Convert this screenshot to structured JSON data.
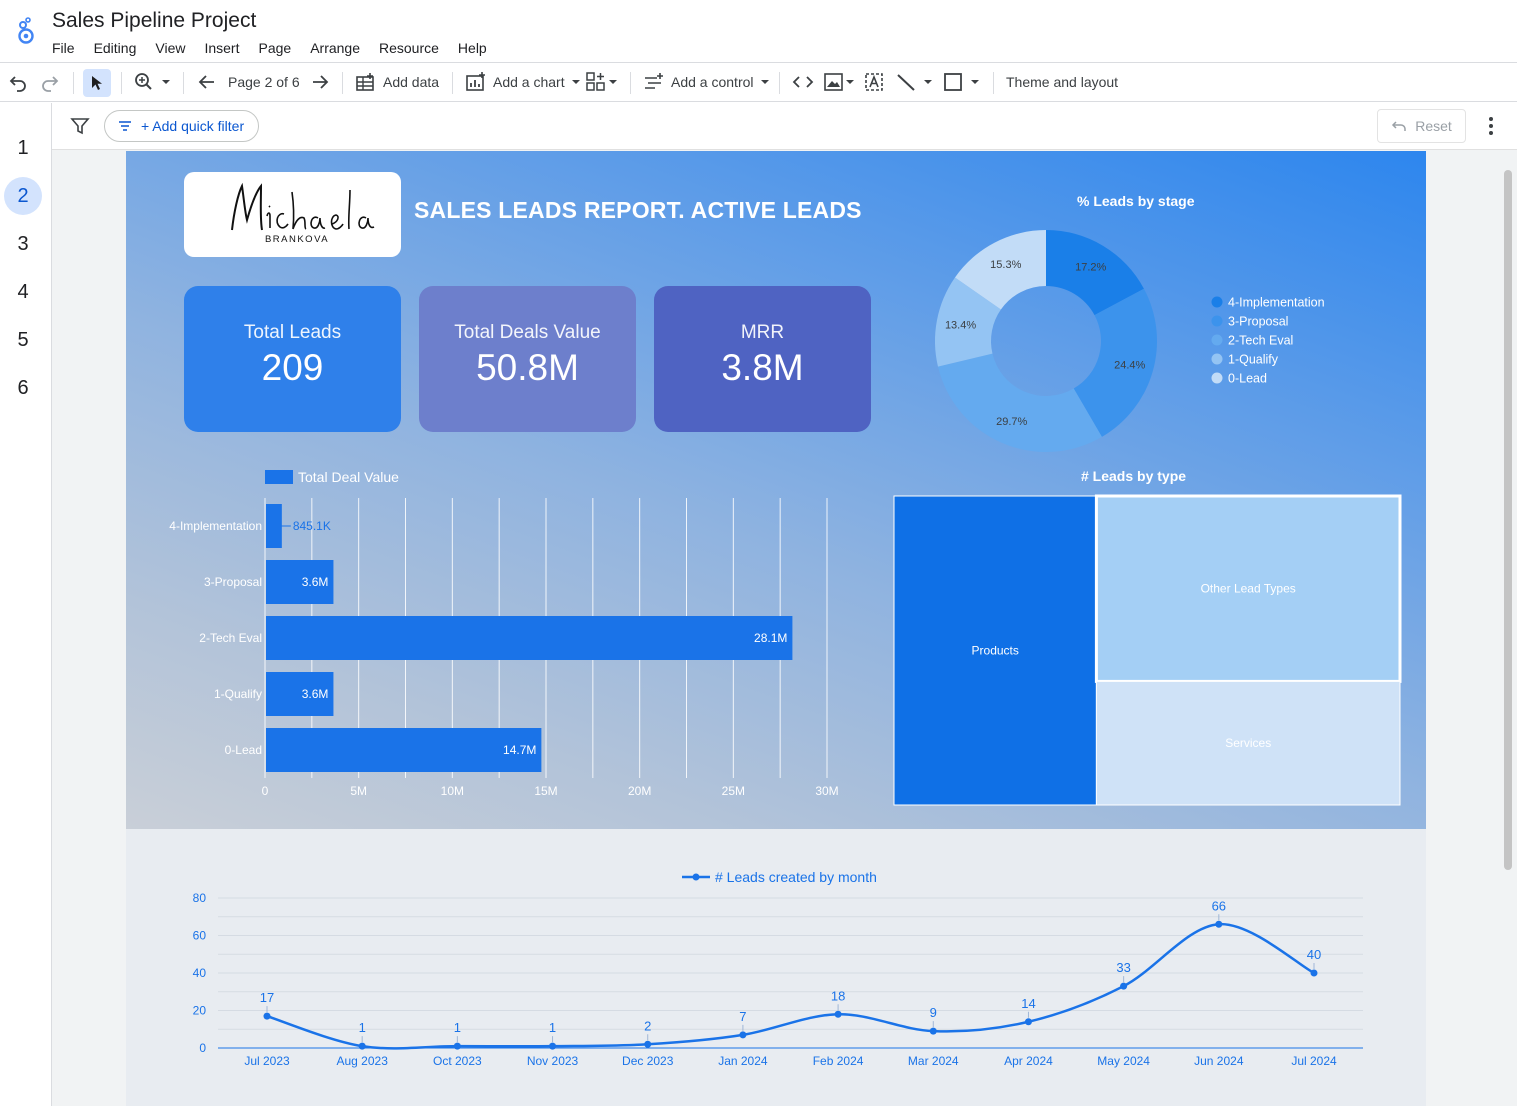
{
  "app": {
    "title": "Sales Pipeline Project",
    "menu": [
      "File",
      "Editing",
      "View",
      "Insert",
      "Page",
      "Arrange",
      "Resource",
      "Help"
    ]
  },
  "toolbar": {
    "page_indicator": "Page 2 of 6",
    "add_data": "Add data",
    "add_chart": "Add a chart",
    "add_control": "Add a control",
    "theme_layout": "Theme and layout"
  },
  "filterbar": {
    "quick_filter": "+ Add quick filter",
    "reset": "Reset"
  },
  "pages": [
    "1",
    "2",
    "3",
    "4",
    "5",
    "6"
  ],
  "active_page": "2",
  "report": {
    "logo_script": "Michaela",
    "logo_sub": "BRANKOVA",
    "title": "SALES LEADS REPORT. ACTIVE LEADS",
    "kpis": [
      {
        "label": "Total Leads",
        "value": "209",
        "color": "#2f80ea"
      },
      {
        "label": "Total Deals Value",
        "value": "50.8M",
        "color": "#6d7fcc"
      },
      {
        "label": "MRR",
        "value": "3.8M",
        "color": "#4f63c2"
      }
    ]
  },
  "chart_data": [
    {
      "type": "pie",
      "title": "% Leads by stage",
      "donut": true,
      "slices": [
        {
          "label": "4-Implementation",
          "value": 17.2,
          "display": "17.2%",
          "color": "#1a7fe8"
        },
        {
          "label": "3-Proposal",
          "value": 24.4,
          "display": "24.4%",
          "color": "#3c93ec"
        },
        {
          "label": "2-Tech Eval",
          "value": 29.7,
          "display": "29.7%",
          "color": "#64aaef"
        },
        {
          "label": "1-Qualify",
          "value": 13.4,
          "display": "13.4%",
          "color": "#94c4f3"
        },
        {
          "label": "0-Lead",
          "value": 15.3,
          "display": "15.3%",
          "color": "#c2dcf7"
        }
      ],
      "legend_position": "right"
    },
    {
      "type": "bar",
      "orientation": "horizontal",
      "series": [
        {
          "name": "Total Deal Value",
          "color": "#1a73e8"
        }
      ],
      "categories": [
        "4-Implementation",
        "3-Proposal",
        "2-Tech Eval",
        "1-Qualify",
        "0-Lead"
      ],
      "values": [
        845100,
        3600000,
        28100000,
        3600000,
        14700000
      ],
      "labels": [
        "845.1K",
        "3.6M",
        "28.1M",
        "3.6M",
        "14.7M"
      ],
      "xticks": [
        "0",
        "5M",
        "10M",
        "15M",
        "20M",
        "25M",
        "30M"
      ],
      "xlim": [
        0,
        30000000
      ],
      "grid": true
    },
    {
      "type": "treemap",
      "title": "# Leads by type",
      "items": [
        {
          "label": "Products",
          "value": 0.4,
          "color": "#0f70e6"
        },
        {
          "label": "Other Lead Types",
          "value": 0.36,
          "color": "#a4cff5"
        },
        {
          "label": "Services",
          "value": 0.24,
          "color": "#cfe2f7"
        }
      ]
    },
    {
      "type": "line",
      "series": [
        {
          "name": "# Leads created by month",
          "color": "#1a73e8"
        }
      ],
      "categories": [
        "Jul 2023",
        "Aug 2023",
        "Oct 2023",
        "Nov 2023",
        "Dec 2023",
        "Jan 2024",
        "Feb 2024",
        "Mar 2024",
        "Apr 2024",
        "May 2024",
        "Jun 2024",
        "Jul 2024"
      ],
      "values": [
        17,
        1,
        1,
        1,
        2,
        7,
        18,
        9,
        14,
        33,
        66,
        40
      ],
      "yticks": [
        "0",
        "20",
        "40",
        "60",
        "80"
      ],
      "ylim": [
        0,
        80
      ],
      "grid": true,
      "smooth": true,
      "legend_position": "top"
    }
  ]
}
